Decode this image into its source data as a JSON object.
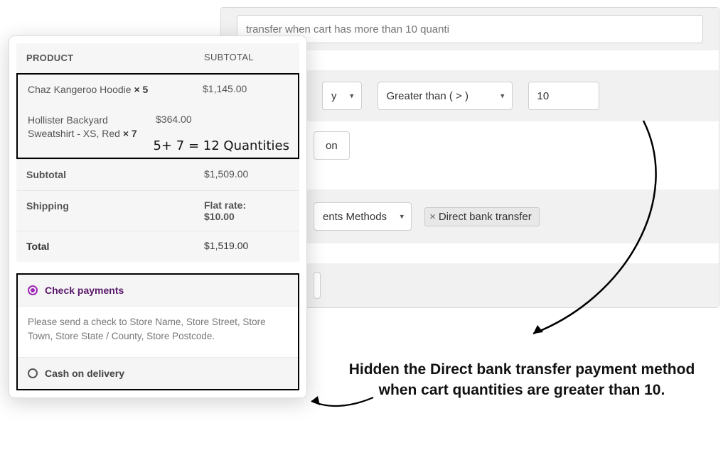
{
  "rule": {
    "title_placeholder": "transfer when cart has more than 10 quanti",
    "pre_select_visible": "y",
    "condition_operator": "Greater than ( > )",
    "condition_value": "10",
    "on_label": "on",
    "action_select_visible": "ents Methods",
    "tag_label": "Direct bank transfer"
  },
  "order": {
    "headers": {
      "product": "PRODUCT",
      "subtotal": "SUBTOTAL"
    },
    "items": [
      {
        "name": "Chaz Kangeroo Hoodie",
        "qty_label": "× 5",
        "price": "$1,145.00"
      },
      {
        "name": "Hollister Backyard Sweatshirt - XS, Red",
        "qty_label": "× 7",
        "price": "$364.00"
      }
    ],
    "qty_annotation": "5+ 7 = 12 Quantities",
    "subtotal_label": "Subtotal",
    "subtotal_value": "$1,509.00",
    "shipping_label": "Shipping",
    "shipping_value_line1": "Flat rate:",
    "shipping_value_line2": "$10.00",
    "total_label": "Total",
    "total_value": "$1,519.00"
  },
  "payments": {
    "check": {
      "label": "Check payments",
      "desc": "Please send a check to Store Name, Store Street, Store Town, Store State / County, Store Postcode."
    },
    "cod": {
      "label": "Cash on delivery"
    }
  },
  "annotation": "Hidden the Direct bank transfer payment method when cart quantities are greater than 10.",
  "icons": {
    "chevron_down": "▾",
    "remove_x": "×"
  }
}
